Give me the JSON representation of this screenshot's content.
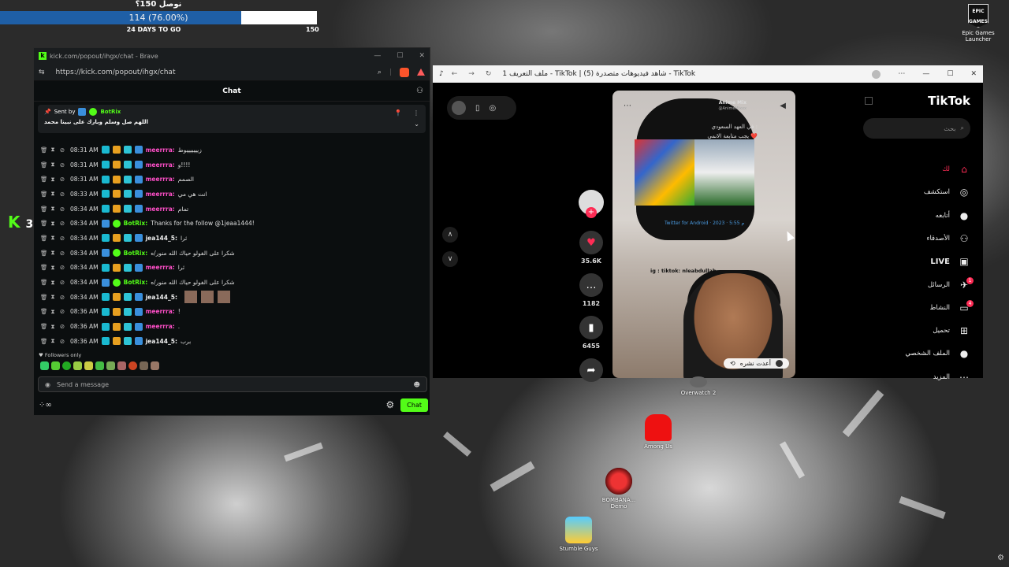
{
  "goal": {
    "title": "نوصل 150؟",
    "progress_text": "114 (76.00%)",
    "current": 114,
    "target": 150,
    "percent": 76.0,
    "days_to_go": "24 DAYS TO GO",
    "max_label": "150",
    "fill_color": "#1f5fa6"
  },
  "kick_window": {
    "tab_title": "kick.com/popout/ihgx/chat - Brave",
    "url": "https://kick.com/popout/ihgx/chat",
    "chat_title": "Chat",
    "pinned": {
      "sent_by_label": "Sent by",
      "sender": "BotRix",
      "message": "اللهم صل وسلم وبارك على نبينا محمد"
    },
    "messages": [
      {
        "time": "08:31 AM",
        "user": "meerrra:",
        "text": "زيييييييوط",
        "color": "pink"
      },
      {
        "time": "08:31 AM",
        "user": "meerrra:",
        "text": "و!!!!",
        "color": "pink"
      },
      {
        "time": "08:31 AM",
        "user": "meerrra:",
        "text": "الصمم",
        "color": "pink"
      },
      {
        "time": "08:33 AM",
        "user": "meerrra:",
        "text": "انت هي مي",
        "color": "pink"
      },
      {
        "time": "08:34 AM",
        "user": "meerrra:",
        "text": "تمام",
        "color": "pink"
      },
      {
        "time": "08:34 AM",
        "user": "BotRix:",
        "text": "Thanks for the follow @1jeaa1444!",
        "color": "green"
      },
      {
        "time": "08:34 AM",
        "user": "jea144_5:",
        "text": "ثرا",
        "color": "white"
      },
      {
        "time": "08:34 AM",
        "user": "BotRix:",
        "text": "شكرا على الفولو حياك الله منور/ه",
        "color": "green"
      },
      {
        "time": "08:34 AM",
        "user": "meerrra:",
        "text": "ثرا",
        "color": "pink"
      },
      {
        "time": "08:34 AM",
        "user": "BotRix:",
        "text": "شكرا على الفولو حياك الله منور/ه",
        "color": "green"
      },
      {
        "time": "08:34 AM",
        "user": "jea144_5:",
        "text": "",
        "color": "white",
        "emotes": 3
      },
      {
        "time": "08:36 AM",
        "user": "meerrra:",
        "text": "!",
        "color": "pink"
      },
      {
        "time": "08:36 AM",
        "user": "meerrra:",
        "text": ".",
        "color": "pink"
      },
      {
        "time": "08:36 AM",
        "user": "jea144_5:",
        "text": "برب",
        "color": "white"
      }
    ],
    "followers_only": "Followers only",
    "input_placeholder": "Send a message",
    "chat_button": "Chat"
  },
  "stream_overlay": {
    "logo_letter": "K",
    "count": "3"
  },
  "tiktok_window": {
    "title": "ملف التعريف 1 - TikTok | شاهد فيديوهات متصدرة (5) - TikTok",
    "logo": "TikTok",
    "search_placeholder": "بحث",
    "nav": [
      {
        "label": "لك",
        "icon": "home-icon",
        "active": true
      },
      {
        "label": "استكشف",
        "icon": "compass-icon"
      },
      {
        "label": "أتابعه",
        "icon": "avatar-icon"
      },
      {
        "label": "الأصدقاء",
        "icon": "friends-icon"
      },
      {
        "label": "LIVE",
        "icon": "live-icon"
      },
      {
        "label": "الرسائل",
        "icon": "messages-icon",
        "badge": "1"
      },
      {
        "label": "النشاط",
        "icon": "activity-icon",
        "badge": "4"
      },
      {
        "label": "تحميل",
        "icon": "upload-icon"
      },
      {
        "label": "الملف الشخصي",
        "icon": "profile-icon"
      },
      {
        "label": "المزيد",
        "icon": "more-icon"
      }
    ],
    "video": {
      "account": "Anime Mix",
      "handle": "@AnimeMixxx",
      "caption_line1": "في العهد السعودي :",
      "caption_line2": "يجب متابعة الانمي ❤️",
      "twitter_text": "Twitter for Android · 2023 · 5:55 م",
      "creator_tag": "ig : tiktok: nleabdullah_",
      "repost_label": "أعدت نشره"
    },
    "actions": {
      "likes": "35.6K",
      "comments": "1182",
      "saves": "6455"
    }
  },
  "desktop_icons": [
    {
      "label": "Epic Games Launcher"
    },
    {
      "label": "Among Us"
    },
    {
      "label": "BOMBANA... Demo"
    },
    {
      "label": "Stumble Guys"
    },
    {
      "label": "Overwatch 2"
    }
  ]
}
